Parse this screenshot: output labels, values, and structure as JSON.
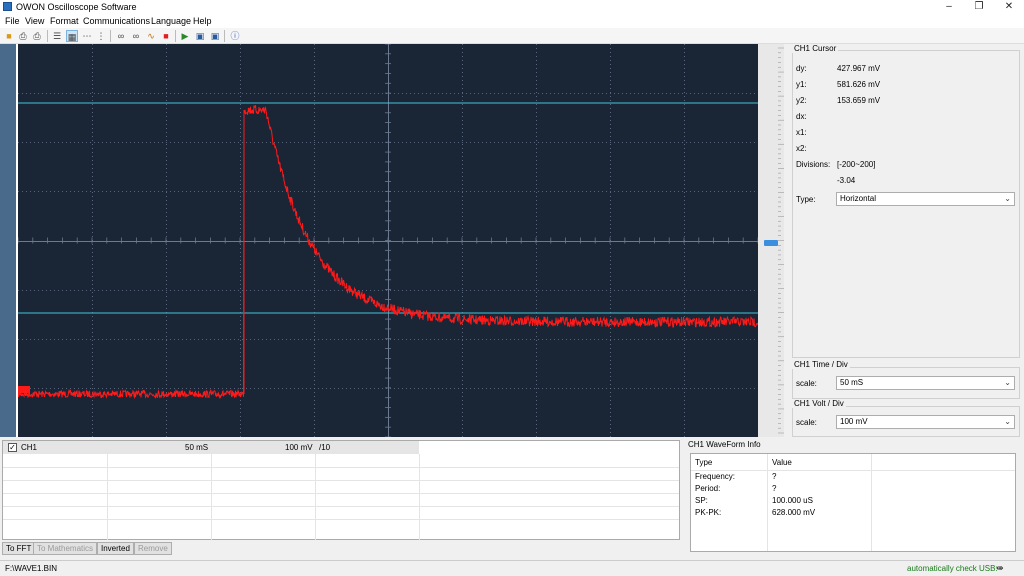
{
  "window": {
    "title": "OWON Oscilloscope Software"
  },
  "menu": [
    "File",
    "View",
    "Format",
    "Communications",
    "Language",
    "Help"
  ],
  "toolbar_icons": [
    "open-folder-icon",
    "print-icon",
    "print-preview-icon",
    "list-icon",
    "grid-icon",
    "dots-icon",
    "dots-small-icon",
    "link-icon",
    "link2-icon",
    "waveform-icon",
    "stop-icon",
    "export-icon",
    "monitor-icon",
    "save-icon",
    "help-icon"
  ],
  "cursor_panel": {
    "title": "CH1 Cursor",
    "rows": [
      {
        "label": "dy:",
        "value": "427.967 mV"
      },
      {
        "label": "y1:",
        "value": "581.626 mV"
      },
      {
        "label": "y2:",
        "value": "153.659 mV"
      },
      {
        "label": "dx:",
        "value": ""
      },
      {
        "label": "x1:",
        "value": ""
      },
      {
        "label": "x2:",
        "value": ""
      },
      {
        "label": "Divisions:",
        "value": "[-200~200]"
      },
      {
        "label": "",
        "value": "-3.04"
      }
    ],
    "type_label": "Type:",
    "type_value": "Horizontal"
  },
  "time_panel": {
    "title": "CH1 Time / Div",
    "scale_label": "scale:",
    "scale_value": "50 mS"
  },
  "volt_panel": {
    "title": "CH1 Volt / Div",
    "scale_label": "scale:",
    "scale_value": "100 mV"
  },
  "channel_table": {
    "name": "CH1",
    "time": "50 mS",
    "volt": "100 mV",
    "probe": "/10"
  },
  "buttons": {
    "fft": "To FFT",
    "math": "To Mathematics",
    "inverted": "Inverted",
    "remove": "Remove"
  },
  "waveform_info": {
    "title": "CH1 WaveForm Info",
    "col_type": "Type",
    "col_value": "Value",
    "rows": [
      {
        "type": "Frequency:",
        "value": "?"
      },
      {
        "type": "Period:",
        "value": "?"
      },
      {
        "type": "SP:",
        "value": "100.000 uS"
      },
      {
        "type": "PK-PK:",
        "value": "628.000 mV"
      }
    ]
  },
  "status": {
    "path": "F:\\WAVE1.BIN",
    "usb": "automatically check USB:"
  },
  "colors": {
    "trace": "#ff1a1a",
    "cursor": "#3fc6dc",
    "screen": "#1a2535",
    "grid": "#6b7a90"
  }
}
